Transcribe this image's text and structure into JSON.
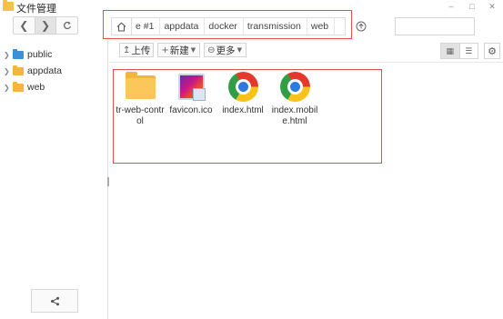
{
  "window": {
    "title": "文件管理",
    "controls": [
      "minimize",
      "maximize",
      "close"
    ]
  },
  "nav": {
    "back_icon": "chevron-left-icon",
    "forward_icon": "chevron-right-icon",
    "refresh_icon": "refresh-icon"
  },
  "breadcrumb": {
    "home_icon": "home-icon",
    "items": [
      "e #1",
      "appdata",
      "docker",
      "transmission",
      "web"
    ],
    "up_icon": "up-arrow-icon"
  },
  "search": {
    "placeholder": "",
    "value": ""
  },
  "sidebar": {
    "items": [
      {
        "label": "public",
        "icon": "shared-folder-icon",
        "color": "#3d8fd8"
      },
      {
        "label": "appdata",
        "icon": "folder-icon",
        "color": "#f4b63f"
      },
      {
        "label": "web",
        "icon": "folder-icon",
        "color": "#f4b63f"
      }
    ],
    "share_icon": "share-icon"
  },
  "actions": {
    "upload": "上传",
    "new": "新建",
    "more": "更多"
  },
  "view": {
    "mode": "grid"
  },
  "files": [
    {
      "name": "tr-web-control",
      "type": "folder",
      "icon": "folder-icon"
    },
    {
      "name": "favicon.ico",
      "type": "image",
      "icon": "image-file-icon"
    },
    {
      "name": "index.html",
      "type": "html",
      "icon": "chrome-icon"
    },
    {
      "name": "index.mobile.html",
      "type": "html",
      "icon": "chrome-icon"
    }
  ],
  "colors": {
    "highlight_box": "#e2514f",
    "folder": "#f6b33d",
    "accent": "#2e7be0"
  }
}
